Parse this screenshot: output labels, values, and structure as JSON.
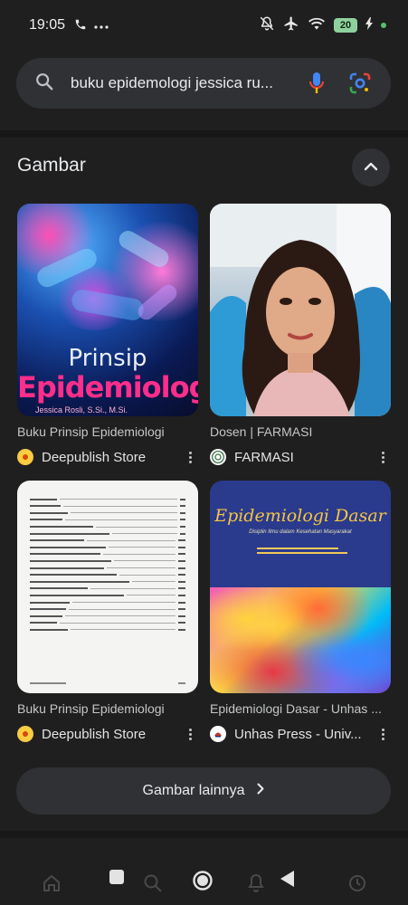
{
  "status_bar": {
    "time": "19:05",
    "battery_level": "20"
  },
  "search": {
    "query": "buku epidemologi jessica ru..."
  },
  "section": {
    "title": "Gambar"
  },
  "results": [
    {
      "title": "Buku Prinsip Epidemiologi",
      "source": "Deepublish Store",
      "cover_title_1": "Prinsip",
      "cover_title_2": "Epidemiologi",
      "cover_author": "Jessica Rosli, S.Si., M.Si."
    },
    {
      "title": "Dosen | FARMASI",
      "source": "FARMASI"
    },
    {
      "title": "Buku Prinsip Epidemiologi",
      "source": "Deepublish Store"
    },
    {
      "title": "Epidemiologi Dasar - Unhas ...",
      "source": "Unhas Press - Univ...",
      "cover_title": "Epidemiologi Dasar",
      "cover_subtitle": "Disiplin Ilmu dalam Kesehatan Masyarakat"
    }
  ],
  "more_images": {
    "label": "Gambar lainnya"
  },
  "colors": {
    "background": "#1f1f1f",
    "surface": "#303134",
    "accent_pink": "#ff2e8a",
    "cover_yellow": "#f5c542"
  }
}
